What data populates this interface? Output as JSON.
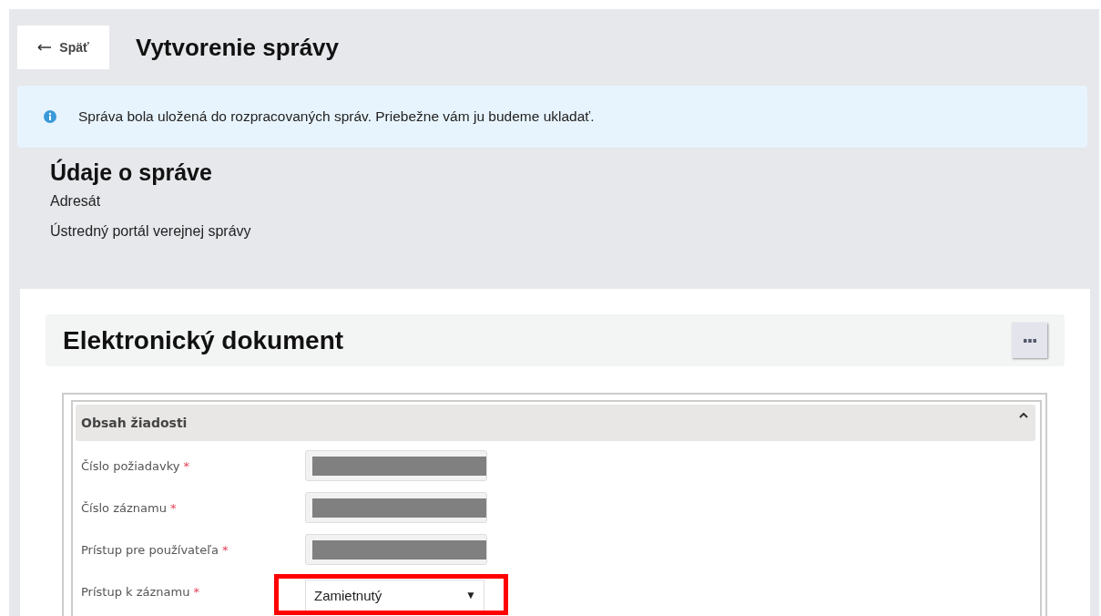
{
  "back_button": {
    "label": "Späť"
  },
  "title": "Vytvorenie správy",
  "alert": {
    "message": "Správa bola uložená do rozpracovaných správ. Priebežne vám ju budeme ukladať."
  },
  "message_info": {
    "heading": "Údaje o správe",
    "label": "Adresát",
    "value": "Ústredný portál verejnej správy"
  },
  "document": {
    "title": "Elektronický dokument",
    "section": {
      "title": "Obsah žiadosti",
      "expanded": true,
      "fields": [
        {
          "label": "Číslo požiadavky",
          "required_mark": "*",
          "kind": "redacted",
          "highlighted": false
        },
        {
          "label": "Číslo záznamu",
          "required_mark": "*",
          "kind": "redacted",
          "highlighted": false
        },
        {
          "label": "Prístup pre používateľa",
          "required_mark": "*",
          "kind": "redacted",
          "highlighted": false
        },
        {
          "label": "Prístup k záznamu",
          "required_mark": "*",
          "kind": "select",
          "value": "Zamietnutý",
          "arrow": "▼",
          "highlighted": true
        }
      ]
    }
  }
}
